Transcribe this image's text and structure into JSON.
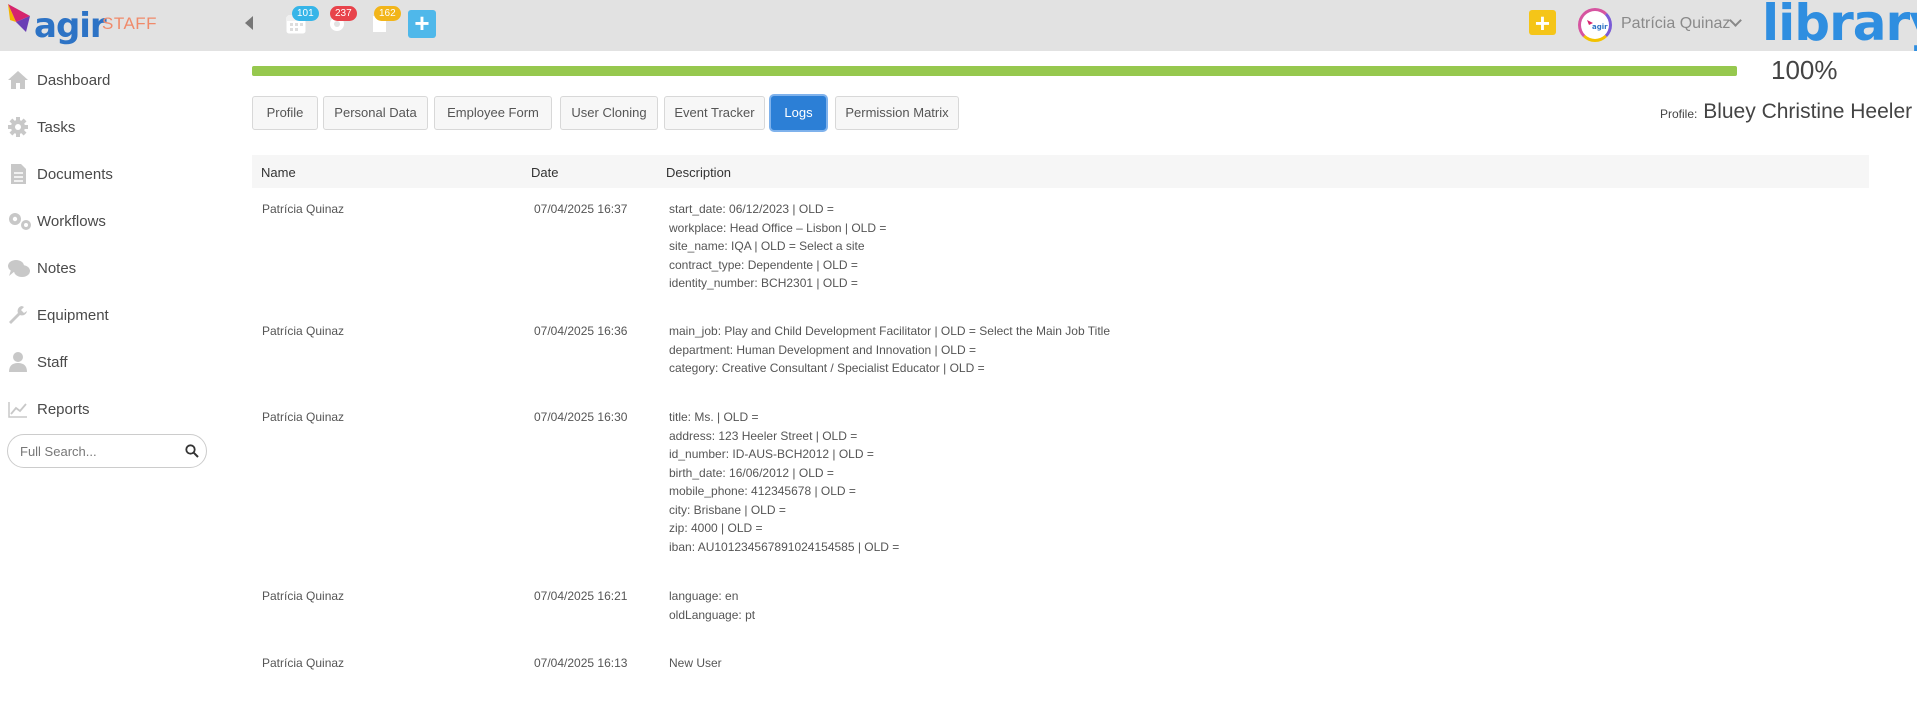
{
  "header": {
    "logo_text": "agir",
    "app_section": "STAFF",
    "badges": [
      {
        "icon": "calendar-icon",
        "count": "101",
        "color": "#36b5e8"
      },
      {
        "icon": "gear-icon",
        "count": "237",
        "color": "#e8434b"
      },
      {
        "icon": "document-icon",
        "count": "162",
        "color": "#f2b51a"
      }
    ],
    "add_button_label": "+",
    "quick_add_label": "+",
    "user_name": "Patrícia Quinaz",
    "brand_logo": "library"
  },
  "sidebar": {
    "items": [
      {
        "label": "Dashboard",
        "icon": "home-icon"
      },
      {
        "label": "Tasks",
        "icon": "gear-icon"
      },
      {
        "label": "Documents",
        "icon": "document-icon"
      },
      {
        "label": "Workflows",
        "icon": "gears-icon"
      },
      {
        "label": "Notes",
        "icon": "comments-icon"
      },
      {
        "label": "Equipment",
        "icon": "wrench-icon"
      },
      {
        "label": "Staff",
        "icon": "user-icon"
      },
      {
        "label": "Reports",
        "icon": "chart-icon"
      }
    ],
    "search_placeholder": "Full Search..."
  },
  "progress": {
    "value": 1.0,
    "label": "100%",
    "color": "#96c84e"
  },
  "tabs": [
    {
      "label": "Profile",
      "active": false
    },
    {
      "label": "Personal Data",
      "active": false
    },
    {
      "label": "Employee Form",
      "active": false
    },
    {
      "label": "User Cloning",
      "active": false
    },
    {
      "label": "Event Tracker",
      "active": false
    },
    {
      "label": "Logs",
      "active": true
    },
    {
      "label": "Permission Matrix",
      "active": false
    }
  ],
  "profile": {
    "caption": "Profile:",
    "name": "Bluey Christine Heeler"
  },
  "logs": {
    "columns": [
      "Name",
      "Date",
      "Description"
    ],
    "rows": [
      {
        "name": "Patrícia Quinaz",
        "date": "07/04/2025 16:37",
        "description": [
          "start_date: 06/12/2023 | OLD =",
          "workplace: Head Office – Lisbon | OLD =",
          "site_name: IQA | OLD = Select a site",
          "contract_type: Dependente | OLD =",
          "identity_number: BCH2301 | OLD ="
        ]
      },
      {
        "name": "Patrícia Quinaz",
        "date": "07/04/2025 16:36",
        "description": [
          "main_job: Play and Child Development Facilitator | OLD = Select the Main Job Title",
          "department: Human Development and Innovation | OLD =",
          "category: Creative Consultant / Specialist Educator | OLD ="
        ]
      },
      {
        "name": "Patrícia Quinaz",
        "date": "07/04/2025 16:30",
        "description": [
          "title: Ms. | OLD =",
          "address: 123 Heeler Street | OLD =",
          "id_number: ID-AUS-BCH2012 | OLD =",
          "birth_date: 16/06/2012 | OLD =",
          "mobile_phone: 412345678 | OLD =",
          "city: Brisbane | OLD =",
          "zip: 4000 | OLD =",
          "iban: AU101234567891024154585 | OLD ="
        ]
      },
      {
        "name": "Patrícia Quinaz",
        "date": "07/04/2025 16:21",
        "description": [
          "language: en",
          "oldLanguage: pt"
        ]
      },
      {
        "name": "Patrícia Quinaz",
        "date": "07/04/2025 16:13",
        "description": [
          "New User"
        ]
      }
    ]
  },
  "colors": {
    "topbar": "#e2e2e2",
    "accent": "#2c7fd6",
    "quick_add": "#f5c518",
    "add_button": "#4fb8ea"
  }
}
